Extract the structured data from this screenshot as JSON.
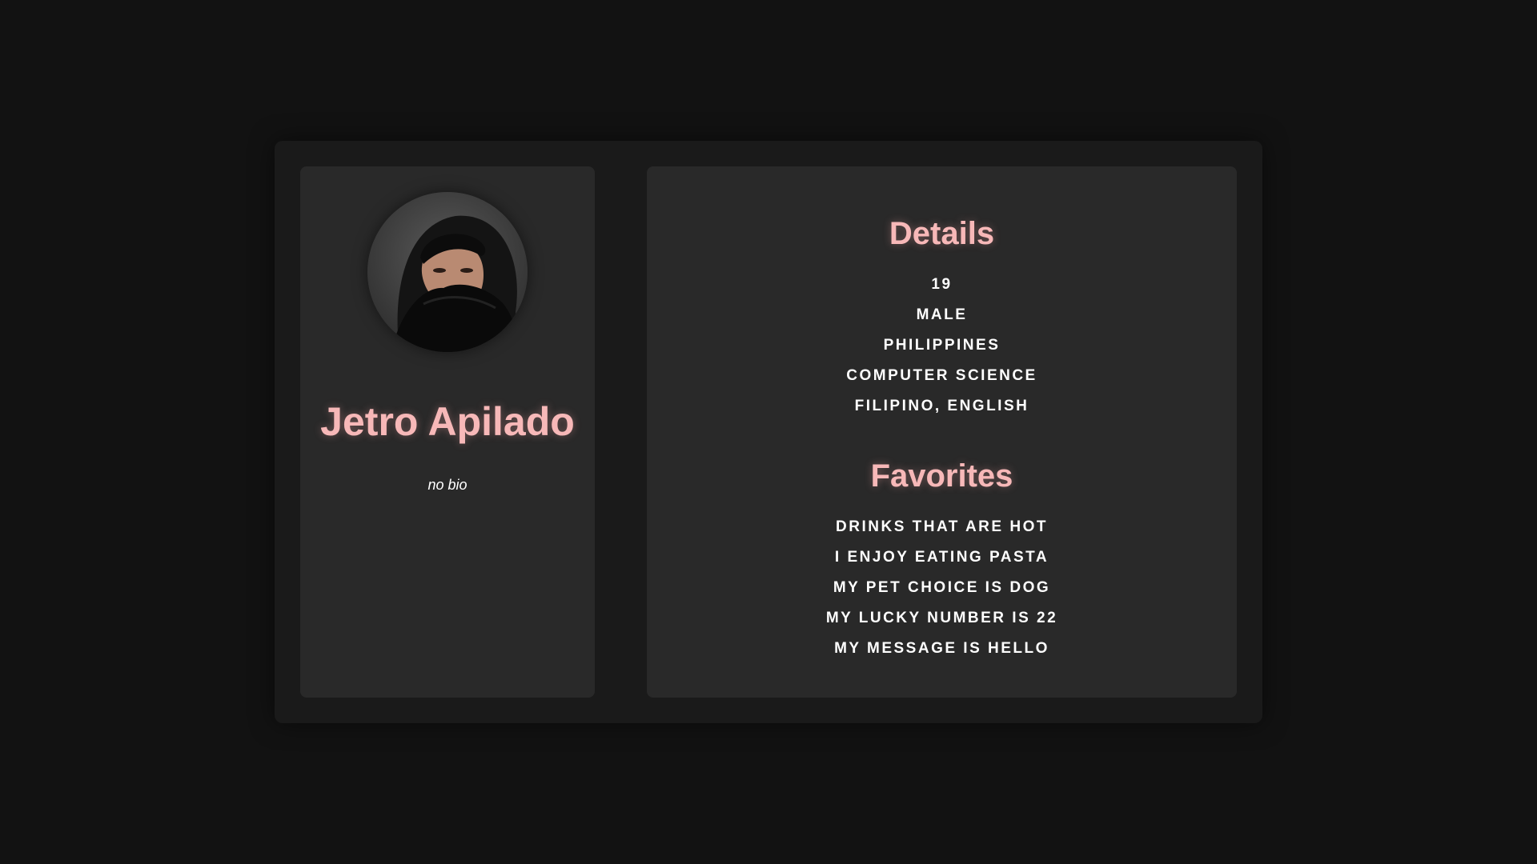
{
  "profile": {
    "name": "Jetro Apilado",
    "bio": "no bio",
    "avatar_icon": "user-photo"
  },
  "details": {
    "title": "Details",
    "items": [
      "19",
      "MALE",
      "PHILIPPINES",
      "COMPUTER SCIENCE",
      "FILIPINO, ENGLISH"
    ]
  },
  "favorites": {
    "title": "Favorites",
    "items": [
      "DRINKS THAT ARE HOT",
      "I ENJOY EATING PASTA",
      "MY PET CHOICE IS DOG",
      "MY LUCKY NUMBER IS 22",
      "MY MESSAGE IS HELLO"
    ]
  },
  "colors": {
    "background": "#121212",
    "outer_card": "#1a1a1a",
    "panel": "#292929",
    "accent": "#f7b8b8",
    "text": "#ffffff"
  }
}
